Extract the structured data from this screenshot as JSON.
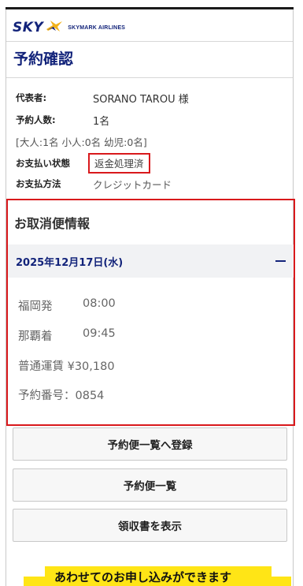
{
  "brand": {
    "sky": "SKY",
    "airline": "SKYMARK AIRLINES",
    "colors": {
      "navy": "#12237a",
      "gold": "#f2b21c",
      "red": "#d9191c"
    }
  },
  "page": {
    "title": "予約確認"
  },
  "info": {
    "rep_label": "代表者:",
    "rep_value": "SORANO TAROU 様",
    "count_label": "予約人数:",
    "count_value": "1名",
    "breakdown": "[大人:1名 小人:0名 幼児:0名]",
    "pay_status_label": "お支払い状態",
    "pay_status_value": "返金処理済",
    "pay_method_label": "お支払方法",
    "pay_method_value": "クレジットカード"
  },
  "cancel": {
    "title": "お取消便情報",
    "date": "2025年12月17日(水)",
    "departure_label": "福岡発",
    "departure_time": "08:00",
    "arrival_label": "那覇着",
    "arrival_time": "09:45",
    "fare": "普通運賃 ¥30,180",
    "booking_no": "予約番号：0854"
  },
  "buttons": {
    "register": "予約便一覧へ登録",
    "list": "予約便一覧",
    "receipt": "領収書を表示"
  },
  "banner": {
    "text": "あわせてのお申し込みができます"
  }
}
